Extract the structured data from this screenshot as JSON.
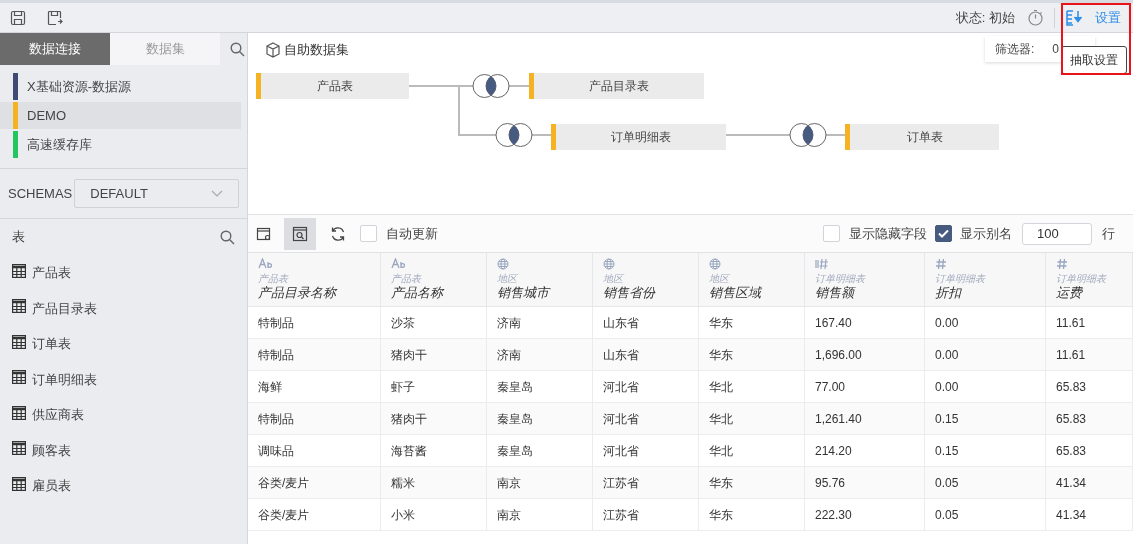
{
  "toolbar": {
    "status": "状态: 初始",
    "settings_link": "设置",
    "tooltip": "抽取设置"
  },
  "left_tabs": [
    {
      "label": "数据连接",
      "selected": true
    },
    {
      "label": "数据集",
      "selected": false
    }
  ],
  "data_sources": [
    {
      "name": "X基础资源-数据源",
      "color": "#3f4a75",
      "selected": false
    },
    {
      "name": "DEMO",
      "color": "#f5b324",
      "selected": true
    },
    {
      "name": "高速缓存库",
      "color": "#22c55e",
      "selected": false
    }
  ],
  "schemas": {
    "label": "SCHEMAS",
    "value": "DEFAULT"
  },
  "tables_panel": {
    "title": "表",
    "items": [
      "产品表",
      "产品目录表",
      "订单表",
      "订单明细表",
      "供应商表",
      "顾客表",
      "雇员表"
    ]
  },
  "dataset": {
    "title": "自助数据集",
    "filter_label": "筛选器:",
    "filter_value": "0",
    "nodes": [
      "产品表",
      "产品目录表",
      "订单明细表",
      "订单表"
    ]
  },
  "grid_toolbar": {
    "auto_update": {
      "label": "自动更新",
      "checked": false
    },
    "show_hidden": {
      "label": "显示隐藏字段",
      "checked": false
    },
    "show_alias": {
      "label": "显示别名",
      "checked": true
    },
    "row_count": "100",
    "row_unit": "行"
  },
  "table": {
    "columns": [
      {
        "kind": "text",
        "source": "产品表",
        "name": "产品目录名称"
      },
      {
        "kind": "text",
        "source": "产品表",
        "name": "产品名称"
      },
      {
        "kind": "geo",
        "source": "地区",
        "name": "销售城市"
      },
      {
        "kind": "geo",
        "source": "地区",
        "name": "销售省份"
      },
      {
        "kind": "geo",
        "source": "地区",
        "name": "销售区域"
      },
      {
        "kind": "measure",
        "source": "订单明细表",
        "name": "销售额"
      },
      {
        "kind": "number",
        "source": "订单明细表",
        "name": "折扣"
      },
      {
        "kind": "number",
        "source": "订单明细表",
        "name": "运费"
      }
    ],
    "rows": [
      [
        "特制品",
        "沙茶",
        "济南",
        "山东省",
        "华东",
        "167.40",
        "0.00",
        "11.61"
      ],
      [
        "特制品",
        "猪肉干",
        "济南",
        "山东省",
        "华东",
        "1,696.00",
        "0.00",
        "11.61"
      ],
      [
        "海鲜",
        "虾子",
        "秦皇岛",
        "河北省",
        "华北",
        "77.00",
        "0.00",
        "65.83"
      ],
      [
        "特制品",
        "猪肉干",
        "秦皇岛",
        "河北省",
        "华北",
        "1,261.40",
        "0.15",
        "65.83"
      ],
      [
        "调味品",
        "海苔酱",
        "秦皇岛",
        "河北省",
        "华北",
        "214.20",
        "0.15",
        "65.83"
      ],
      [
        "谷类/麦片",
        "糯米",
        "南京",
        "江苏省",
        "华东",
        "95.76",
        "0.05",
        "41.34"
      ],
      [
        "谷类/麦片",
        "小米",
        "南京",
        "江苏省",
        "华东",
        "222.30",
        "0.05",
        "41.34"
      ]
    ]
  }
}
